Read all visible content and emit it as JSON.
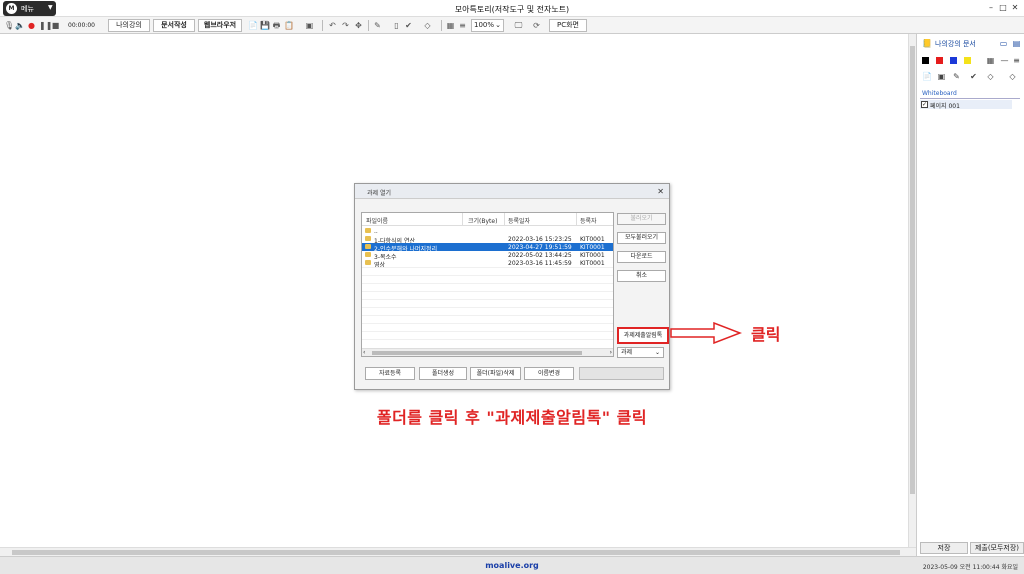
{
  "window": {
    "title": "모아특토리(저작도구 및 전자노트)",
    "menu_label": "메뉴",
    "menu_logo": "M"
  },
  "toolbar": {
    "timer": "00:00:00",
    "my_lecture": "나의강의",
    "doc_create": "문서작성",
    "web_browser": "웹브라우저",
    "zoom": "100%",
    "pc_screen": "PC화면"
  },
  "right_panel": {
    "title": "나의강의 문서",
    "section": "Whiteboard",
    "page_item": "페이지 001",
    "save_label": "저장",
    "submit_label": "제출(모두저장)",
    "swatch_colors": [
      "#000000",
      "#e51c1c",
      "#1b39d8",
      "#f4e21a"
    ]
  },
  "dialog": {
    "title": "과제 열기",
    "columns": [
      "파일이름",
      "크기(Byte)",
      "등록일자",
      "등록자"
    ],
    "rows": [
      {
        "name": "..",
        "size": "",
        "date": "",
        "user": ""
      },
      {
        "name": "1-다항식의 연산",
        "size": "",
        "date": "2022-03-16 15:23:25",
        "user": "KIT0001"
      },
      {
        "name": "2-인수분해와 나머지정리",
        "size": "",
        "date": "2023-04-27 19:51:59",
        "user": "KIT0001"
      },
      {
        "name": "3-복소수",
        "size": "",
        "date": "2022-05-02 13:44:25",
        "user": "KIT0001"
      },
      {
        "name": "영상",
        "size": "",
        "date": "2023-03-16 11:45:59",
        "user": "KIT0001"
      }
    ],
    "selected_row": 2,
    "side_buttons": {
      "load": "불러오기",
      "load_all": "모두불러오기",
      "download": "다운로드",
      "cancel": "취소",
      "notify": "과제제출알림톡"
    },
    "select_value": "과제",
    "bottom_buttons": {
      "upload": "자료등록",
      "create_folder": "폴더생성",
      "delete": "폴더(파일)삭제",
      "rename": "이름변경"
    }
  },
  "annotation": {
    "click_label": "클릭",
    "instruction": "폴더를 클릭 후 \"과제제출알림톡\" 클릭",
    "color": "#e02424"
  },
  "status": {
    "url": "moalive.org",
    "datetime": "2023-05-09 오전 11:00:44 화요일"
  }
}
